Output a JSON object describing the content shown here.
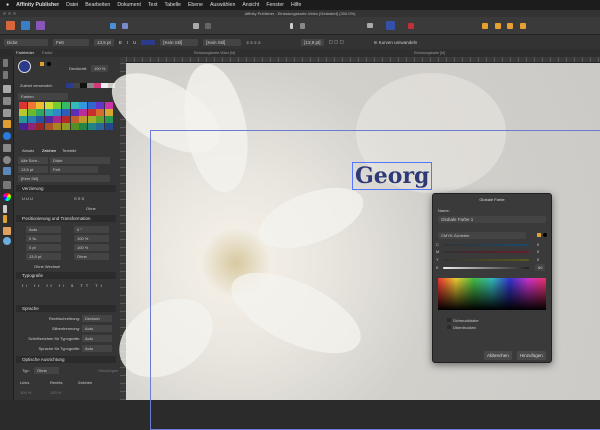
{
  "menubar": {
    "apple": "",
    "app": "Affinity Publisher",
    "items": [
      "Datei",
      "Bearbeiten",
      "Dokument",
      "Text",
      "Tabelle",
      "Ebene",
      "Auswählen",
      "Ansicht",
      "Fenster",
      "Hilfe"
    ]
  },
  "window": {
    "title": "Affinity Publisher - Einladungskarte-Video [Geändert] (300.0%)"
  },
  "context": {
    "font": "Didot",
    "style": "Fett",
    "size": "13,5 pt",
    "bold": "B",
    "italic": "I",
    "underline": "U",
    "char_style": "[Kein Stil]",
    "para_style": "[Kein Stil]",
    "leading": "[13,9 pt]",
    "convert": "In Kurven umwandeln"
  },
  "tabs": {
    "doc": "Einladungskarte-Video [M]",
    "doc2": "Einladungskarte [M]"
  },
  "panel": {
    "tabs": [
      "Farbfelder",
      "Farbe"
    ],
    "opacity_label": "Deckkraft:",
    "opacity": "100 %",
    "recent_label": "Zuletzt verwendet:",
    "palette": "Farben",
    "char_tabs": [
      "Absatz",
      "Zeichen",
      "Textstile"
    ],
    "font_collection": "Alle Schr...",
    "font": "Didot",
    "size": "13,5 pt",
    "weight": "Fett",
    "style": "[Kein Stil]",
    "decoration": "Verzierung",
    "ohne": "Ohne",
    "position": "Positionierung und Transformation",
    "kerning": "Auto",
    "tracking": "0 ‰",
    "baseline": "0 pt",
    "leading": "13,9 pt",
    "skew": "0 °",
    "hscale": "100 %",
    "vscale": "100 %",
    "case": "Ohne",
    "no_break": "Ohne Wechsel",
    "typography": "Typografie",
    "language": "Sprache",
    "lang_rows": [
      {
        "label": "Rechtschreibung:",
        "value": "Deutsch"
      },
      {
        "label": "Silbentrennung:",
        "value": "Auto"
      },
      {
        "label": "Schriftzeichen für Typografie:",
        "value": "Auto"
      },
      {
        "label": "Sprache für Typografie:",
        "value": "Auto"
      }
    ],
    "optical": "Optische Ausrichtung",
    "type_label": "Typ:",
    "type": "Ohne",
    "add": "Hinzufügen",
    "cols": [
      "Links",
      "Rechts",
      "Zeichen"
    ],
    "col_vals": [
      "100 %",
      "100 %",
      ""
    ]
  },
  "canvas": {
    "text": "Georg"
  },
  "dialog": {
    "title": "Globale Farbe",
    "name_label": "Name:",
    "name": "Globale Farbe 1",
    "mode": "CMYK-Schieber",
    "c": "0",
    "m": "0",
    "y": "0",
    "k": "60",
    "c_label": "C",
    "m_label": "M",
    "y_label": "Y",
    "k_label": "K",
    "spot": "Schmuckfarbe",
    "overprint": "Überdrucken",
    "cancel": "Abbrechen",
    "add": "Hinzufügen"
  },
  "colors": {
    "accent": "#2e3a78",
    "fill": "#2b3a8a"
  }
}
